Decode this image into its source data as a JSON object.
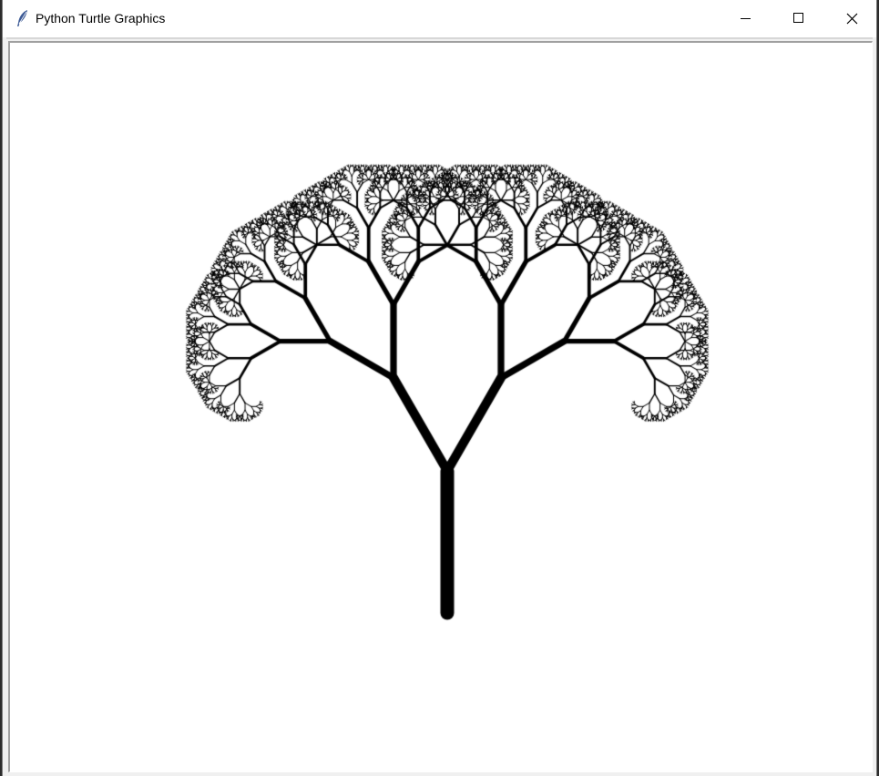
{
  "window": {
    "title": "Python Turtle Graphics",
    "icon": "feather-icon"
  },
  "controls": {
    "minimize_icon": "minimize-icon",
    "maximize_icon": "maximize-icon",
    "close_icon": "close-icon"
  },
  "drawing": {
    "subject": "fractal tree",
    "pen_color": "#000000",
    "background": "#ffffff",
    "recursion_depth": 13,
    "branch_angle_degrees": 30,
    "length_ratio": 0.68,
    "twist_degrees": 10
  }
}
